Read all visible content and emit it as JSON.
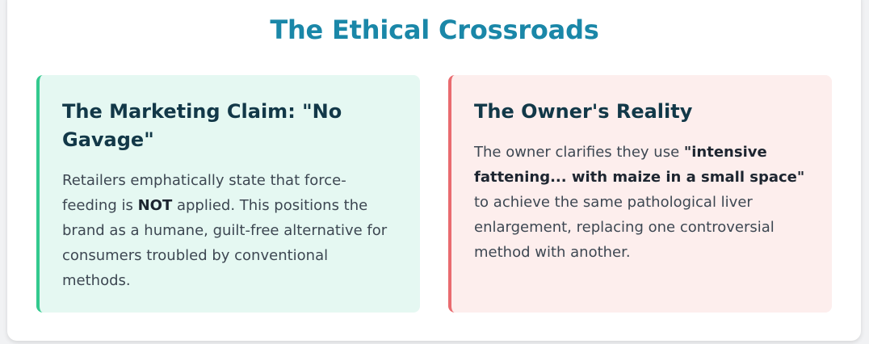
{
  "title": "The Ethical Crossroads",
  "cards": [
    {
      "heading": "The Marketing Claim: \"No Gavage\"",
      "text_1": "Retailers emphatically state that force-feeding is ",
      "emphasis": "NOT",
      "text_2": " applied. This positions the brand as a humane, guilt-free alternative for consumers troubled by conventional methods.",
      "accent_color": "#33c98e",
      "background_color": "#e5f8f2"
    },
    {
      "heading": "The Owner's Reality",
      "text_1": "The owner clarifies they use ",
      "emphasis": "\"intensive fattening... with maize in a small space\"",
      "text_2": " to achieve the same pathological liver enlargement, replacing one controversial method with another.",
      "accent_color": "#e96b6f",
      "background_color": "#fdeeed"
    }
  ],
  "title_color": "#1a87a8"
}
